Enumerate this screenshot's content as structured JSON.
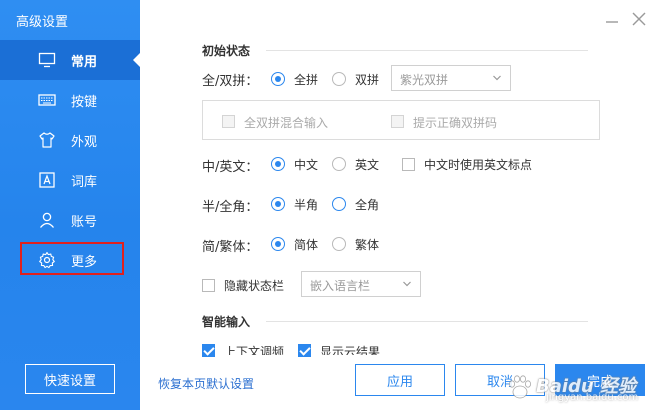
{
  "window": {
    "title": "高级设置"
  },
  "sidebar": {
    "items": [
      {
        "label": "常用",
        "icon": "monitor-icon"
      },
      {
        "label": "按键",
        "icon": "keyboard-icon"
      },
      {
        "label": "外观",
        "icon": "tshirt-icon"
      },
      {
        "label": "词库",
        "icon": "dictionary-icon"
      },
      {
        "label": "账号",
        "icon": "user-icon"
      },
      {
        "label": "更多",
        "icon": "gear-icon"
      }
    ],
    "active_index": 0,
    "quick_setup_label": "快速设置"
  },
  "sections": {
    "initial_state": "初始状态",
    "smart_input": "智能输入"
  },
  "settings": {
    "pinyin": {
      "label": "全/双拼：",
      "options": [
        "全拼",
        "双拼"
      ],
      "selected": "全拼",
      "scheme_select": "紫光双拼",
      "mixed_input": "全双拼混合输入",
      "show_correct": "提示正确双拼码"
    },
    "cn_en": {
      "label": "中/英文：",
      "options": [
        "中文",
        "英文"
      ],
      "selected": "中文",
      "punct_checkbox": "中文时使用英文标点"
    },
    "width": {
      "label": "半/全角：",
      "options": [
        "半角",
        "全角"
      ],
      "selected": "半角"
    },
    "script": {
      "label": "简/繁体：",
      "options": [
        "简体",
        "繁体"
      ],
      "selected": "简体"
    },
    "status_bar": {
      "hide_label": "隐藏状态栏",
      "mode_select": "嵌入语言栏"
    },
    "smart": {
      "context_label": "上下文调频",
      "cloud_label": "显示云结果"
    }
  },
  "footer": {
    "restore_label": "恢复本页默认设置",
    "apply_label": "应用",
    "cancel_label": "取消",
    "done_label": "完成"
  },
  "watermark": {
    "brand": "Baidu 经验",
    "url": "jingyan.baidu.com"
  },
  "colors": {
    "sidebar_bg": "#2a88ef",
    "accent": "#2b87ee",
    "highlight_box": "#e0201e"
  }
}
